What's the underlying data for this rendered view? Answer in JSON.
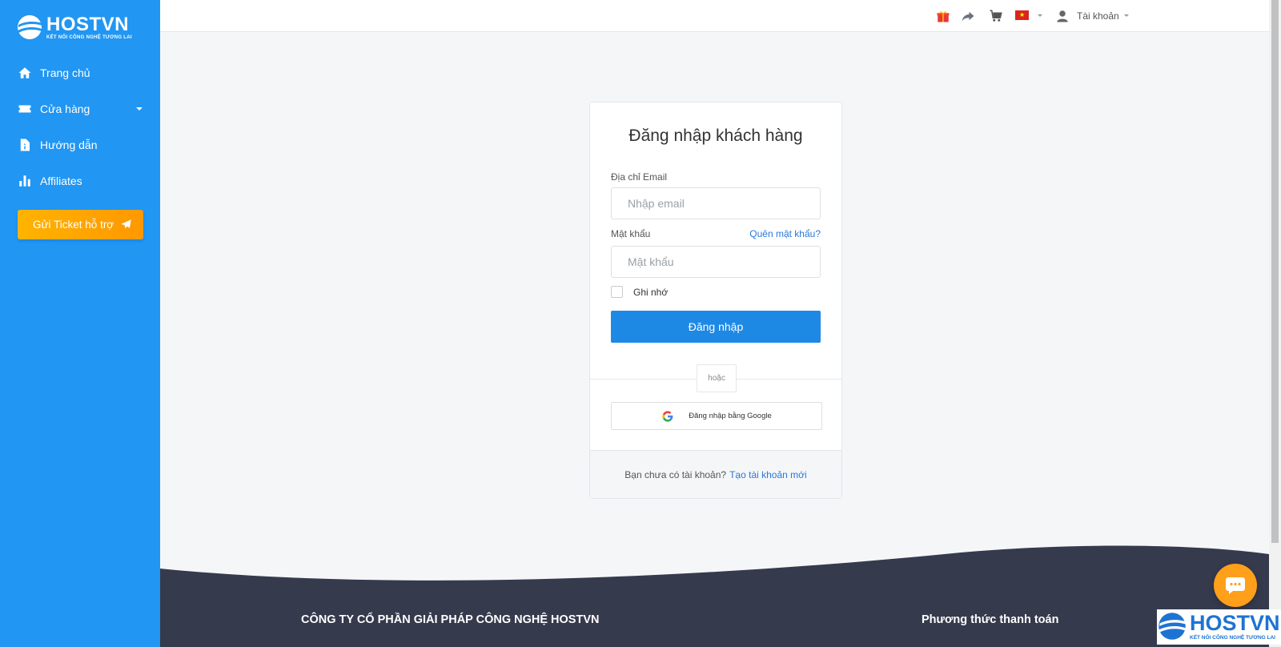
{
  "brand": {
    "name": "HOSTVN",
    "tagline": "KẾT NỐI CÔNG NGHỆ TƯƠNG LAI",
    "color": "#2196f3"
  },
  "sidebar": {
    "items": [
      {
        "label": "Trang chủ",
        "icon": "home-icon"
      },
      {
        "label": "Cửa hàng",
        "icon": "ticket-icon"
      },
      {
        "label": "Hướng dẫn",
        "icon": "document-icon"
      },
      {
        "label": "Affiliates",
        "icon": "bar-chart-icon"
      }
    ],
    "ticket_button": "Gửi Ticket hỗ trợ"
  },
  "topbar": {
    "icons": [
      "gift-icon",
      "share-icon",
      "cart-icon",
      "flag-vietnam-icon",
      "user-icon"
    ],
    "account_label": "Tài khoản"
  },
  "login": {
    "title": "Đăng nhập khách hàng",
    "email_label": "Địa chỉ Email",
    "email_placeholder": "Nhập email",
    "password_label": "Mật khẩu",
    "forgot_link": "Quên mật khẩu?",
    "password_placeholder": "Mật khẩu",
    "remember_label": "Ghi nhớ",
    "submit_label": "Đăng nhập",
    "or_label": "hoặc",
    "google_label": "Đăng nhập bằng Google",
    "no_account_text": "Bạn chưa có tài khoản?",
    "signup_link": "Tạo tài khoản mới"
  },
  "footer": {
    "company": "CÔNG TY CỔ PHẦN GIẢI PHÁP CÔNG NGHỆ HOSTVN",
    "payment_heading": "Phương thức thanh toán",
    "color": "#363a4d"
  },
  "colors": {
    "primary": "#1e88e5",
    "accent": "#ff9800",
    "link": "#2979d8"
  }
}
